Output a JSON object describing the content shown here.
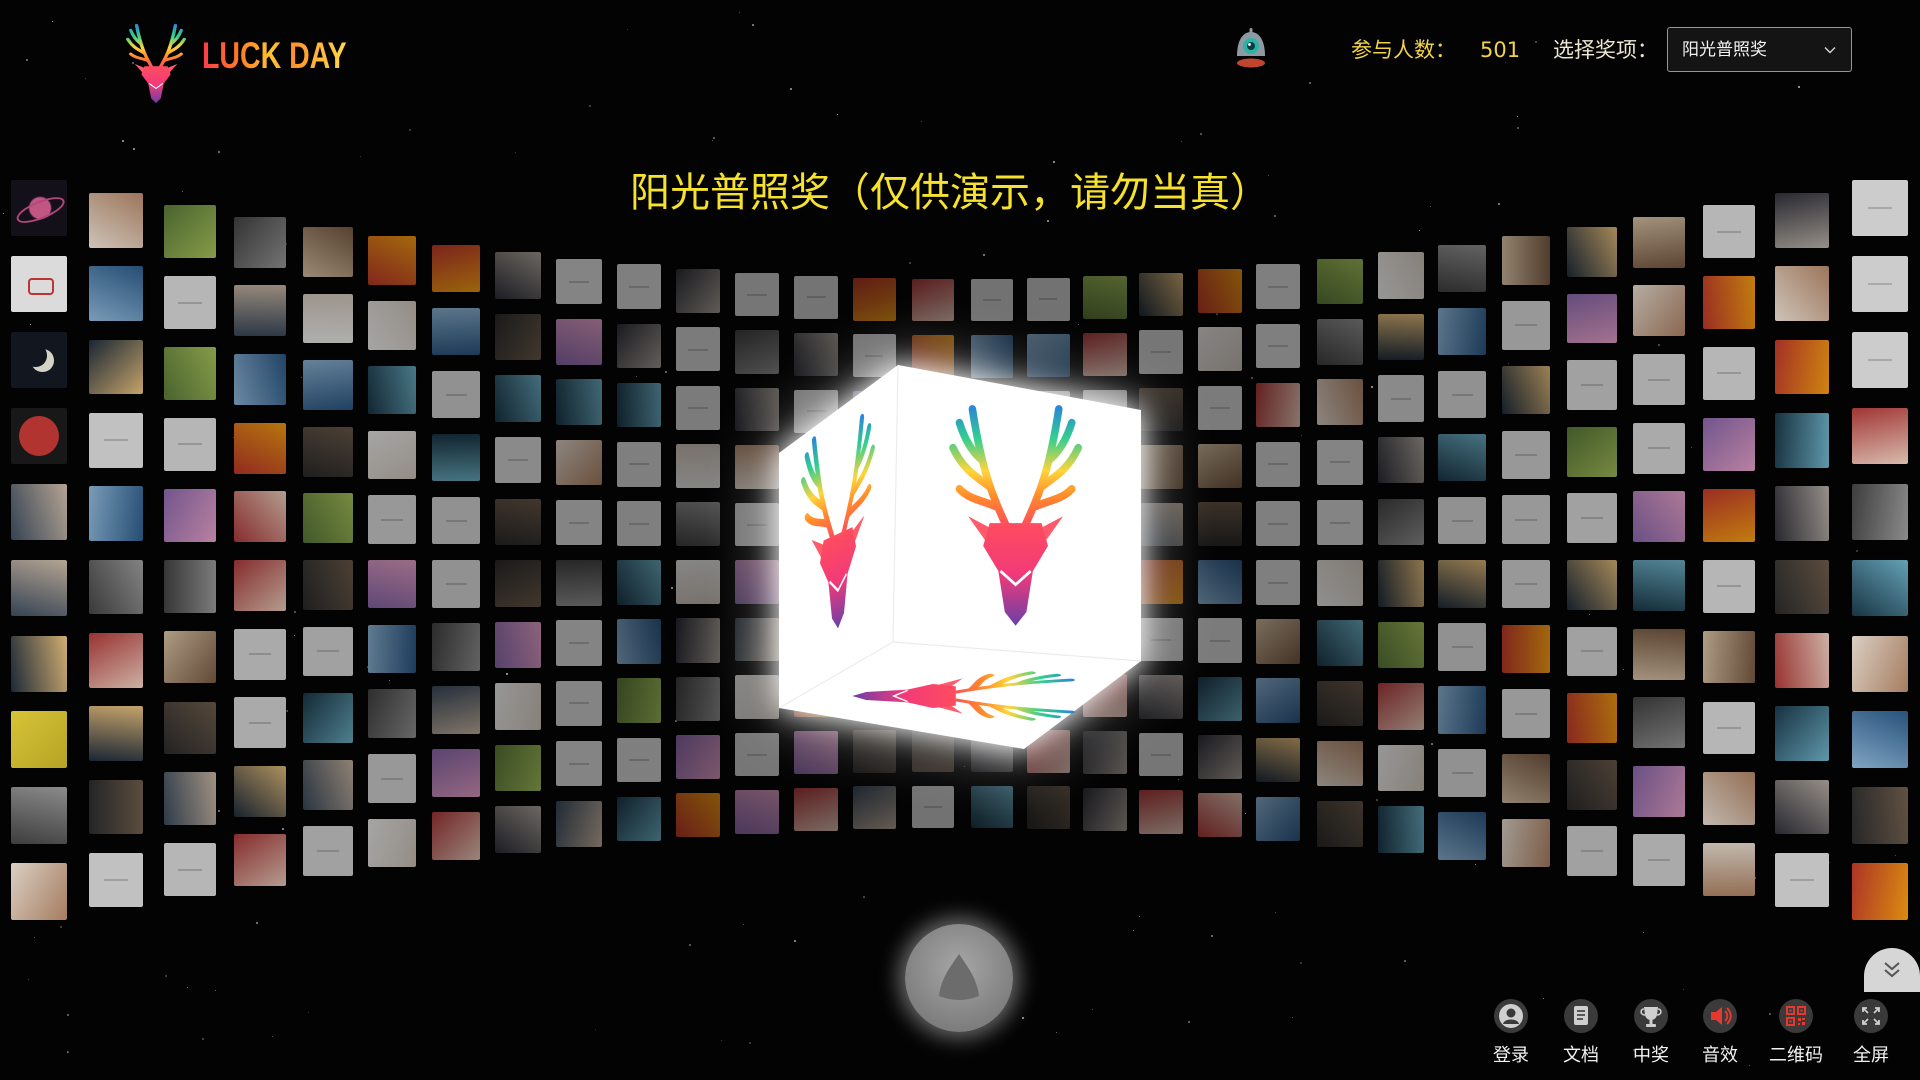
{
  "brand": {
    "name": "LUCK DAY",
    "logo_icon": "deer-logo-icon"
  },
  "header": {
    "status_icon": "robot-icon",
    "participants_label": "参与人数：",
    "participants_count": "501",
    "prize_label": "选择奖项：",
    "prize_select": {
      "selected": "阳光普照奖",
      "icon": "chevron-down-icon"
    }
  },
  "stage": {
    "title": "阳光普照奖（仅供演示，请勿当真）",
    "cube_icon": "deer-cube-icon",
    "start_button_icon": "rocket-icon"
  },
  "collapse_button_icon": "double-chevron-down-icon",
  "toolbar": [
    {
      "label": "登录",
      "icon": "user-circle-icon"
    },
    {
      "label": "文档",
      "icon": "document-icon"
    },
    {
      "label": "中奖",
      "icon": "trophy-icon"
    },
    {
      "label": "音效",
      "icon": "speaker-icon"
    },
    {
      "label": "二维码",
      "icon": "qr-code-icon"
    },
    {
      "label": "全屏",
      "icon": "fullscreen-icon"
    }
  ],
  "colors": {
    "background": "#030303",
    "title": "#f6e22c",
    "participants": "#f2d24b",
    "select_border": "#a6946c",
    "sound_icon": "#e5392f",
    "qr_icon": "#e5392f"
  }
}
